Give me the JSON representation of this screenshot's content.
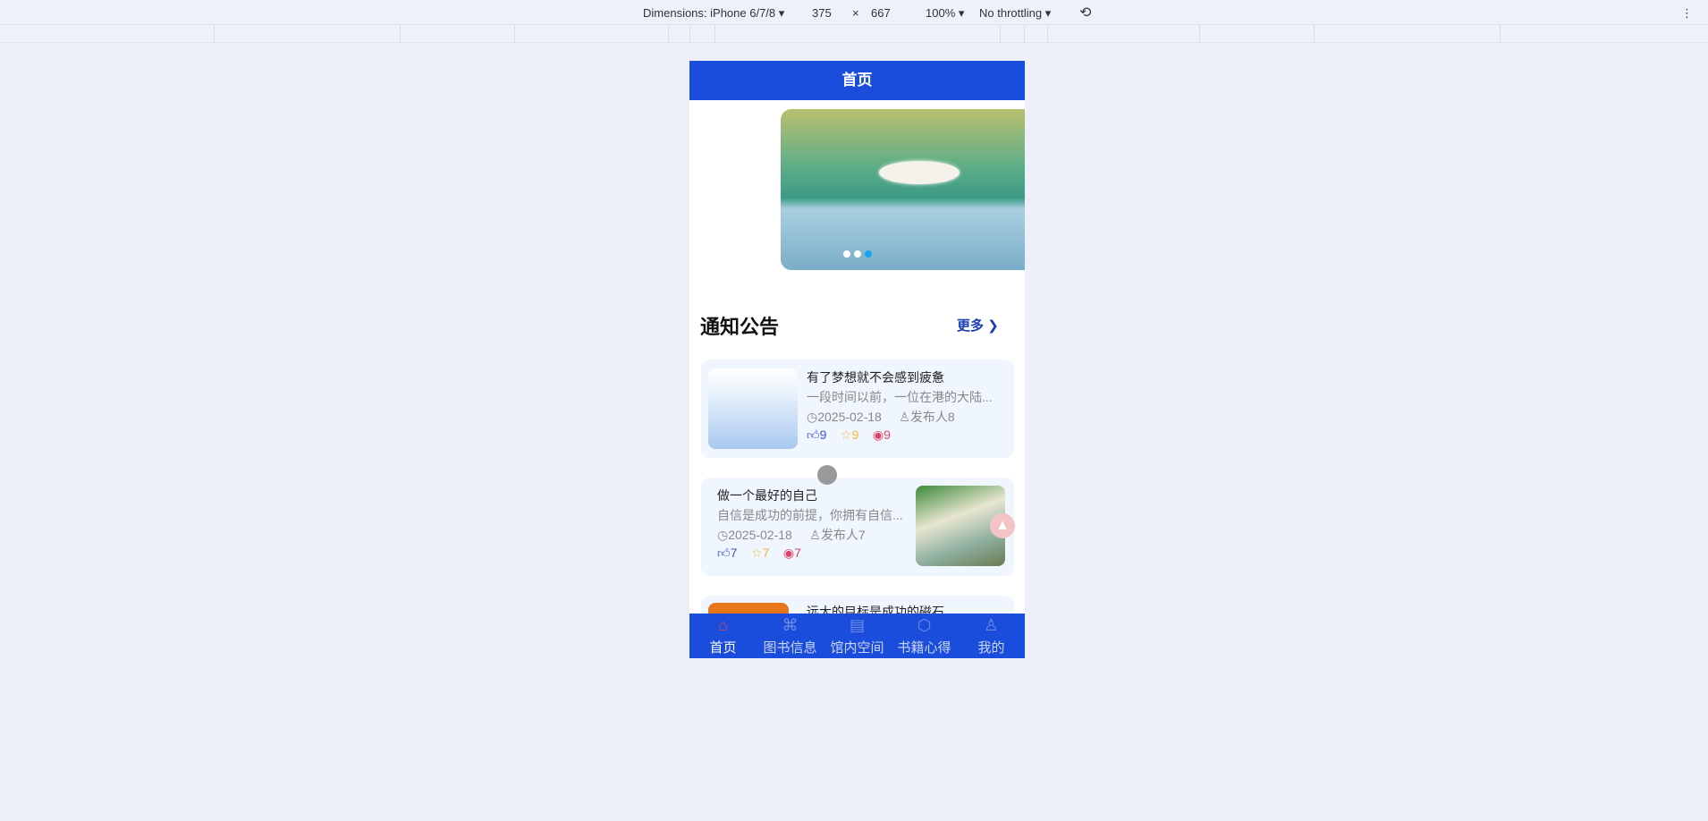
{
  "devtools": {
    "dimensions": "Dimensions: iPhone 6/7/8 ▾",
    "width": "375",
    "times": "×",
    "height": "667",
    "zoom": "100% ▾",
    "throttling": "No throttling ▾",
    "rotate_icon": "rotate-icon"
  },
  "header": {
    "title": "首页"
  },
  "carousel": {
    "dots": 3,
    "active": 3
  },
  "notices": {
    "title": "通知公告",
    "more": "更多",
    "items": [
      {
        "title": "有了梦想就不会感到疲惫",
        "desc": "一段时间以前，一位在港的大陆...",
        "date": "2025-02-18",
        "author": "发布人8",
        "likes": "9",
        "stars": "9",
        "views": "9"
      },
      {
        "title": "做一个最好的自己",
        "desc": "自信是成功的前提，你拥有自信...",
        "date": "2025-02-18",
        "author": "发布人7",
        "likes": "7",
        "stars": "7",
        "views": "7"
      },
      {
        "title": "远大的目标是成功的磁石"
      }
    ]
  },
  "tabbar": [
    {
      "label": "首页",
      "icon": "home-icon"
    },
    {
      "label": "图书信息",
      "icon": "grid-icon"
    },
    {
      "label": "馆内空间",
      "icon": "calendar-icon"
    },
    {
      "label": "书籍心得",
      "icon": "box-icon"
    },
    {
      "label": "我的",
      "icon": "user-icon"
    }
  ],
  "colors": {
    "primary": "#1b4ddc",
    "like": "#3b57c7",
    "star": "#f0b840",
    "view": "#e0436a"
  }
}
